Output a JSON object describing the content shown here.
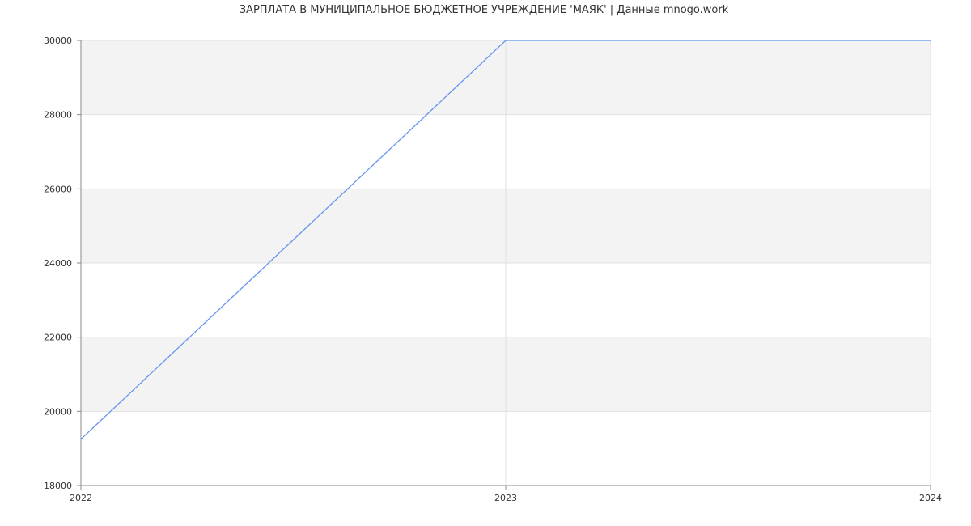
{
  "chart_data": {
    "type": "line",
    "title": "ЗАРПЛАТА В МУНИЦИПАЛЬНОЕ БЮДЖЕТНОЕ УЧРЕЖДЕНИЕ 'МАЯК' | Данные mnogo.work",
    "xlabel": "",
    "ylabel": "",
    "x": [
      "2022",
      "2023",
      "2024"
    ],
    "series": [
      {
        "values": [
          19250,
          30000,
          30000
        ]
      }
    ],
    "ylim": [
      18000,
      30000
    ],
    "yticks": [
      18000,
      20000,
      22000,
      24000,
      26000,
      28000,
      30000
    ],
    "grid": true,
    "band_fill": "#f3f3f3",
    "line_color": "#6495ed"
  }
}
